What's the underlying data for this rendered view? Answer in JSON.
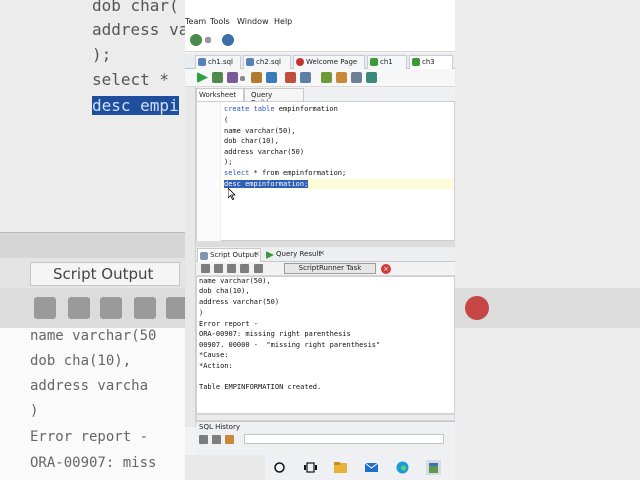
{
  "menu": {
    "team": "Team",
    "tools": "Tools",
    "window": "Window",
    "help": "Help"
  },
  "doc_tabs": [
    {
      "label": "ch1.sql",
      "color": "#5b7fb8"
    },
    {
      "label": "ch2.sql",
      "color": "#5b7fb8"
    },
    {
      "label": "Welcome Page",
      "color": "#c8312c"
    },
    {
      "label": "ch1",
      "color": "#3a9a3a"
    },
    {
      "label": "ch3",
      "color": "#3a9a3a",
      "active": true
    }
  ],
  "worksheet_tabs": {
    "worksheet": "Worksheet",
    "query_builder": "Query Builder"
  },
  "editor_lines": [
    {
      "kw": "create table",
      "rest": " empinformation"
    },
    {
      "kw": "",
      "rest": "("
    },
    {
      "kw": "",
      "rest": "name varchar(50),"
    },
    {
      "kw": "",
      "rest": "dob char(10),"
    },
    {
      "kw": "",
      "rest": "address varchar(50)"
    },
    {
      "kw": "",
      "rest": ");"
    },
    {
      "kw": "select",
      "rest": " * from empinformation;"
    },
    {
      "kw": "",
      "rest": "desc empinformation;"
    }
  ],
  "output_tabs": {
    "script_output": "Script Output",
    "query_result": "Query Result"
  },
  "output_toolbar": {
    "task_label": "ScriptRunner Task"
  },
  "output_lines": [
    "name varchar(50),",
    "dob cha(10),",
    "address varchar(50)",
    ")",
    "Error report -",
    "ORA-00907: missing right parenthesis",
    "00907. 00000 -  \"missing right parenthesis\"",
    "*Cause:",
    "*Action:",
    "",
    "Table EMPINFORMATION created."
  ],
  "sql_history": {
    "label": "SQL History"
  },
  "background_zoom": {
    "code_lines": [
      "dob char(",
      "address va",
      ");",
      "select *",
      "desc empi"
    ],
    "tab_label": "Script Output",
    "output_lines": [
      "name varchar(50",
      "dob cha(10),",
      "address varcha",
      ")",
      "Error report -",
      "ORA-00907: miss"
    ]
  },
  "colors": {
    "keyword": "#2a55c4",
    "selection": "#2f5fb7",
    "error_red": "#d23a3a"
  }
}
